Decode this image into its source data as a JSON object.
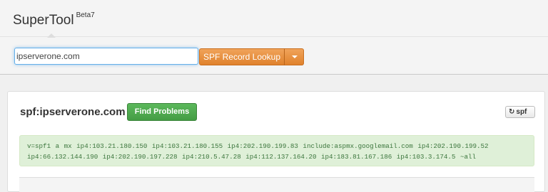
{
  "header": {
    "brand": "SuperTool",
    "brand_version": "Beta7"
  },
  "search": {
    "value": "ipserverone.com",
    "lookup_button": "SPF Record Lookup"
  },
  "result": {
    "title": "spf:ipserverone.com",
    "find_problems_button": "Find Problems",
    "refresh_button": "spf",
    "spf_record": "v=spf1 a mx ip4:103.21.180.150 ip4:103.21.180.155 ip4:202.190.199.83 include:aspmx.googlemail.com ip4:202.190.199.52 ip4:66.132.144.190 ip4:202.190.197.228 ip4:210.5.47.28 ip4:112.137.164.20 ip4:183.81.167.186 ip4:103.3.174.5 ~all"
  },
  "colors": {
    "accent_orange": "#e0822d",
    "success_green": "#449d44",
    "record_bg": "#dff0d8",
    "record_text": "#3c763d",
    "focus_blue": "#66afe9"
  },
  "icons": {
    "refresh": "refresh-icon",
    "dropdown": "chevron-down-icon"
  }
}
